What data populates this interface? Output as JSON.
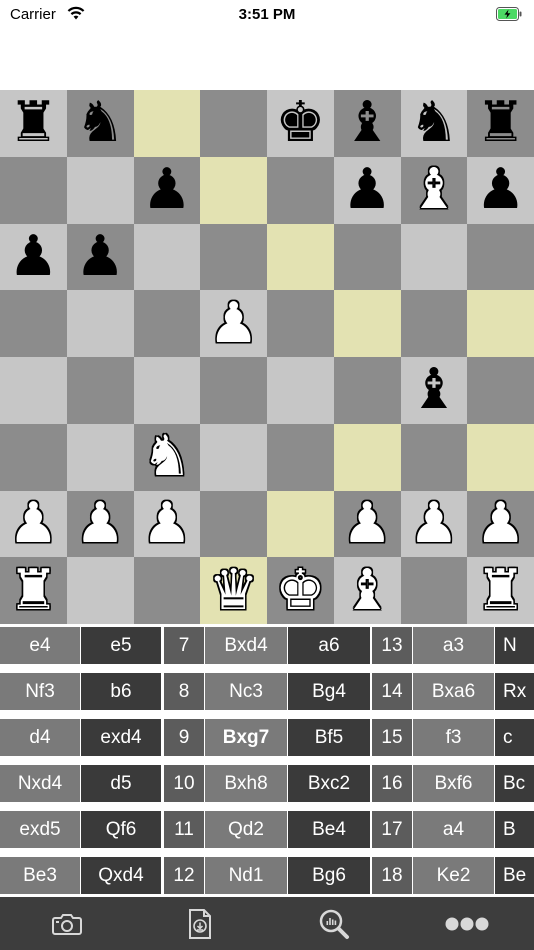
{
  "status_bar": {
    "carrier": "Carrier",
    "time": "3:51 PM"
  },
  "colors": {
    "light_square": "#c6c6c6",
    "dark_square": "#8c8c8c",
    "highlight": "#e3e2b2"
  },
  "board": {
    "ranks": [
      [
        "bR",
        "bN",
        "",
        "",
        "bK",
        "bB",
        "bN",
        "bR"
      ],
      [
        "",
        "",
        "bP",
        "",
        "",
        "bP",
        "wB",
        "bP"
      ],
      [
        "bP",
        "bP",
        "",
        "",
        "",
        "",
        "",
        ""
      ],
      [
        "",
        "",
        "",
        "wP",
        "",
        "",
        "",
        ""
      ],
      [
        "",
        "",
        "",
        "",
        "",
        "",
        "bB",
        ""
      ],
      [
        "",
        "",
        "wN",
        "",
        "",
        "",
        "",
        ""
      ],
      [
        "wP",
        "wP",
        "wP",
        "",
        "",
        "wP",
        "wP",
        "wP"
      ],
      [
        "wR",
        "",
        "",
        "wQ",
        "wK",
        "wB",
        "",
        "wR"
      ]
    ],
    "highlighted": [
      "c8",
      "d7",
      "e6",
      "e2",
      "d1",
      "f5",
      "h5",
      "f3",
      "h3"
    ]
  },
  "moves": {
    "rows": [
      {
        "c1": "e4",
        "c2": "e5",
        "n2": "7",
        "c3": "Bxd4",
        "c4": "a6",
        "n3": "13",
        "c5": "a3",
        "c6": "N"
      },
      {
        "c1": "Nf3",
        "c2": "b6",
        "n2": "8",
        "c3": "Nc3",
        "c4": "Bg4",
        "n3": "14",
        "c5": "Bxa6",
        "c6": "Rx"
      },
      {
        "c1": "d4",
        "c2": "exd4",
        "n2": "9",
        "c3": "Bxg7",
        "c4": "Bf5",
        "n3": "15",
        "c5": "f3",
        "c6": "c"
      },
      {
        "c1": "Nxd4",
        "c2": "d5",
        "n2": "10",
        "c3": "Bxh8",
        "c4": "Bxc2",
        "n3": "16",
        "c5": "Bxf6",
        "c6": "Bc"
      },
      {
        "c1": "exd5",
        "c2": "Qf6",
        "n2": "11",
        "c3": "Qd2",
        "c4": "Be4",
        "n3": "17",
        "c5": "a4",
        "c6": "B"
      },
      {
        "c1": "Be3",
        "c2": "Qxd4",
        "n2": "12",
        "c3": "Nd1",
        "c4": "Bg6",
        "n3": "18",
        "c5": "Ke2",
        "c6": "Be"
      }
    ],
    "current": "Bxg7"
  },
  "tabbar": {
    "tabs": [
      "camera-icon",
      "document-icon",
      "analysis-icon",
      "more-icon"
    ]
  }
}
